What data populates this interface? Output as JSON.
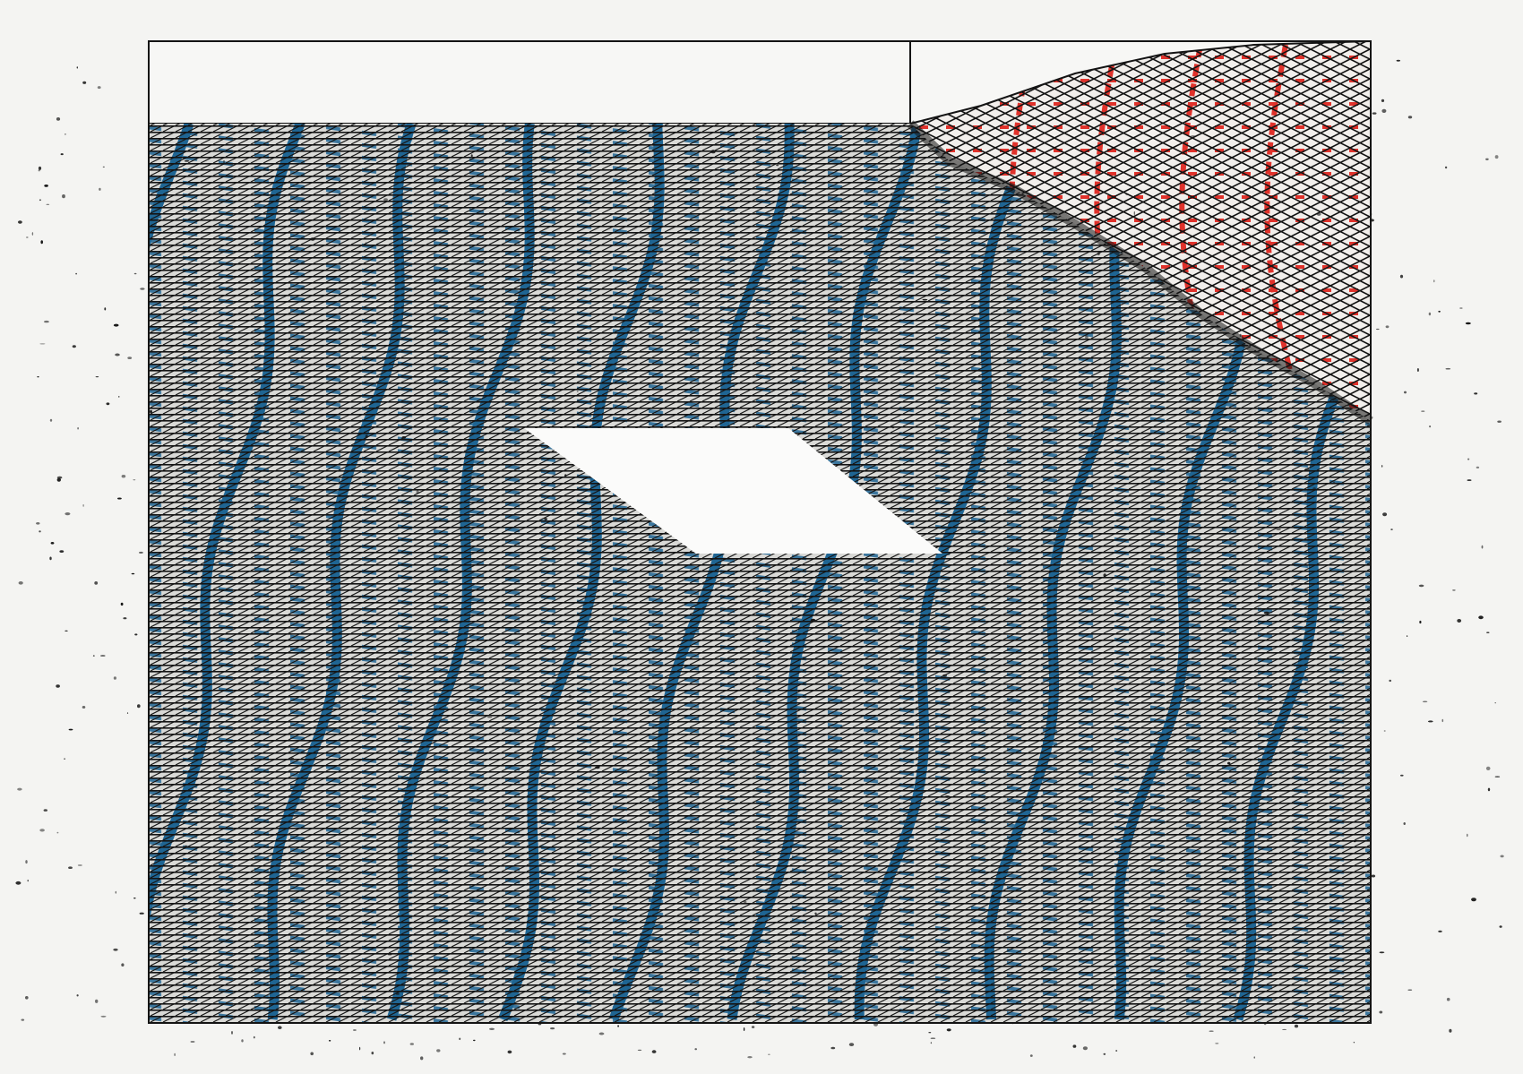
{
  "artwork": {
    "subject": "abstract print",
    "colors": {
      "paper": "#f4f4f2",
      "ink": "#141414",
      "blue": "#1f6593",
      "red": "#e0322b",
      "void": "#fbfbfa"
    },
    "regions": [
      {
        "name": "top-band",
        "fill": "paper"
      },
      {
        "name": "hatched-field",
        "fill": "ink-hatch",
        "accent": "blue"
      },
      {
        "name": "diamond-mesh",
        "fill": "ink-mesh",
        "accent": "red"
      },
      {
        "name": "parallelogram-void",
        "fill": "void"
      }
    ],
    "blue_bands": 10,
    "red_bands": 4
  }
}
